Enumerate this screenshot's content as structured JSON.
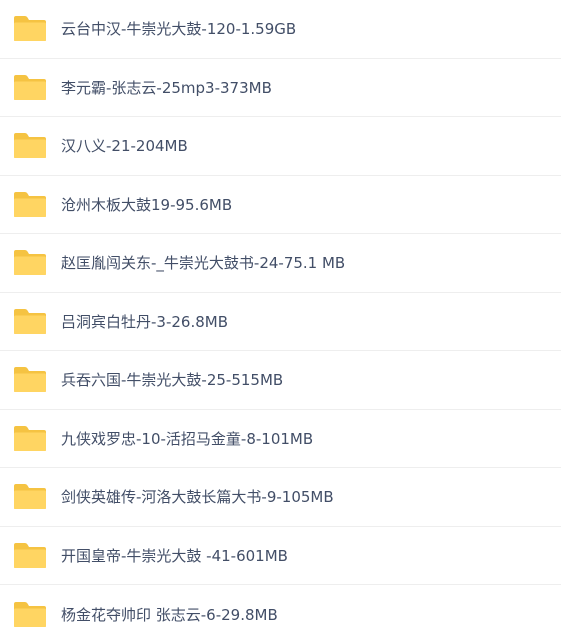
{
  "icon": {
    "name": "folder-icon",
    "color_back": "#f5c342",
    "color_front": "#ffd562"
  },
  "text_color": "#424e67",
  "folders": [
    {
      "name": "云台中汉-牛崇光大鼓-120-1.59GB"
    },
    {
      "name": "李元霸-张志云-25mp3-373MB"
    },
    {
      "name": "汉八义-21-204MB"
    },
    {
      "name": "沧州木板大鼓19-95.6MB"
    },
    {
      "name": "赵匡胤闯关东-_牛崇光大鼓书-24-75.1 MB"
    },
    {
      "name": "吕洞宾白牡丹-3-26.8MB"
    },
    {
      "name": "兵吞六国-牛崇光大鼓-25-515MB"
    },
    {
      "name": "九侠戏罗忠-10-活招马金童-8-101MB"
    },
    {
      "name": "剑侠英雄传-河洛大鼓长篇大书-9-105MB"
    },
    {
      "name": "开国皇帝-牛崇光大鼓 -41-601MB"
    },
    {
      "name": "杨金花夺帅印 张志云-6-29.8MB"
    }
  ]
}
